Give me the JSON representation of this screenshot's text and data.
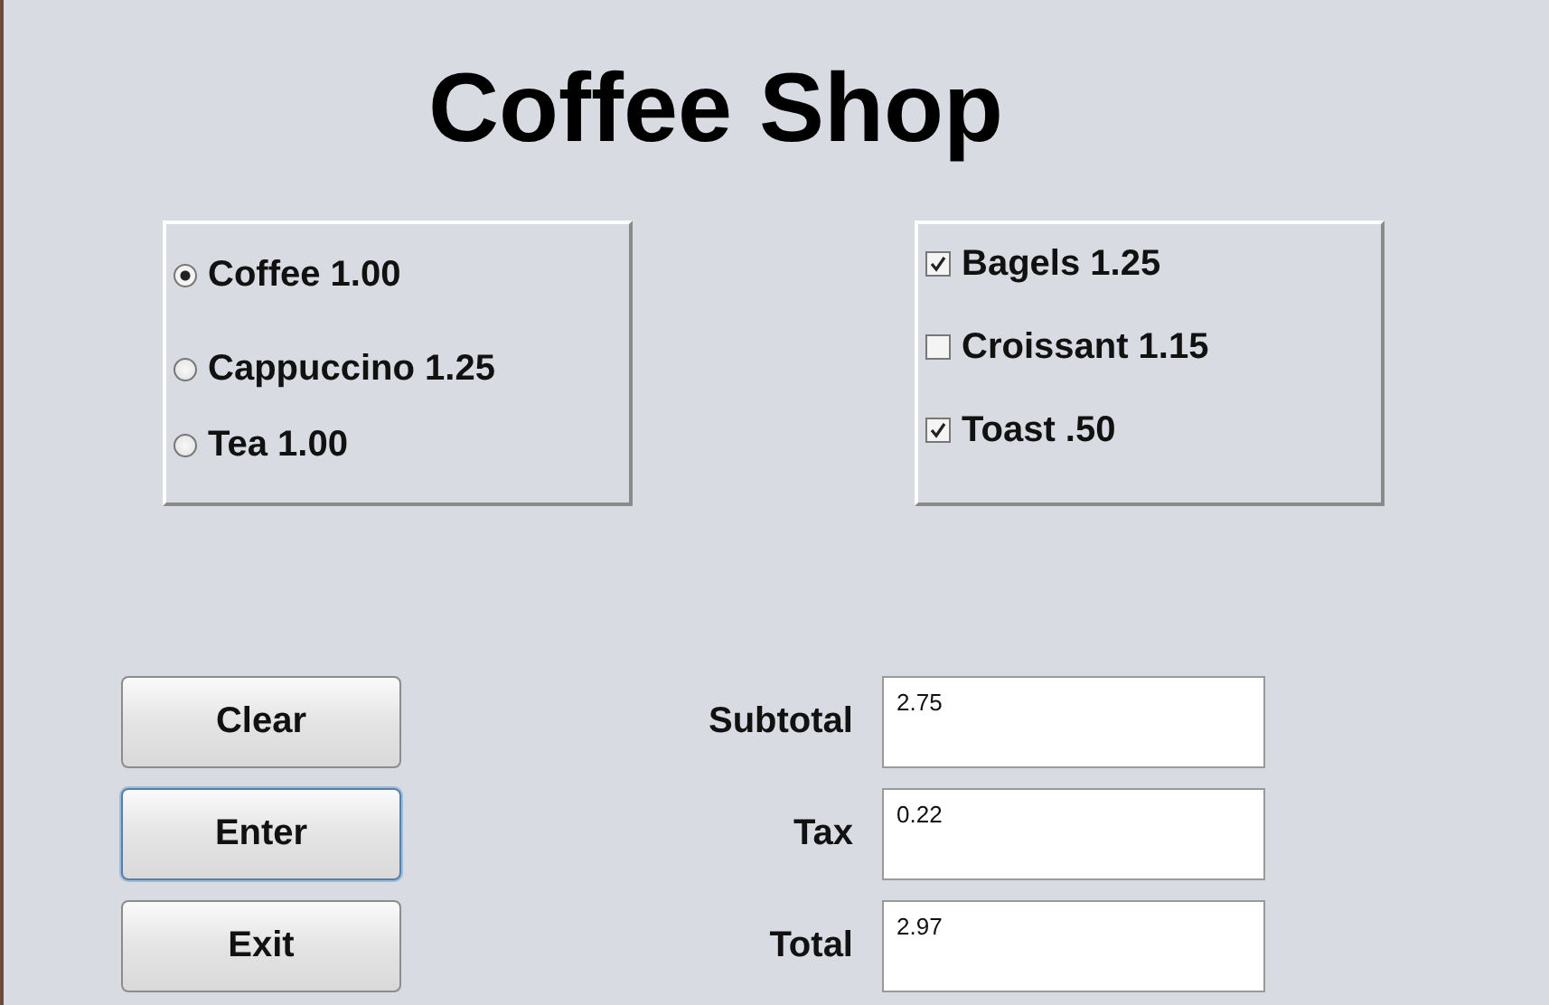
{
  "title": "Coffee Shop",
  "drinks": [
    {
      "label": "Coffee 1.00",
      "selected": true
    },
    {
      "label": "Cappuccino 1.25",
      "selected": false
    },
    {
      "label": "Tea 1.00",
      "selected": false
    }
  ],
  "extras": [
    {
      "label": "Bagels 1.25",
      "checked": true
    },
    {
      "label": "Croissant 1.15",
      "checked": false
    },
    {
      "label": "Toast .50",
      "checked": true
    }
  ],
  "buttons": [
    {
      "label": "Clear",
      "focused": false
    },
    {
      "label": "Enter",
      "focused": true
    },
    {
      "label": "Exit",
      "focused": false
    }
  ],
  "totals": [
    {
      "label": "Subtotal",
      "value": "2.75"
    },
    {
      "label": "Tax",
      "value": "0.22"
    },
    {
      "label": "Total",
      "value": "2.97"
    }
  ]
}
